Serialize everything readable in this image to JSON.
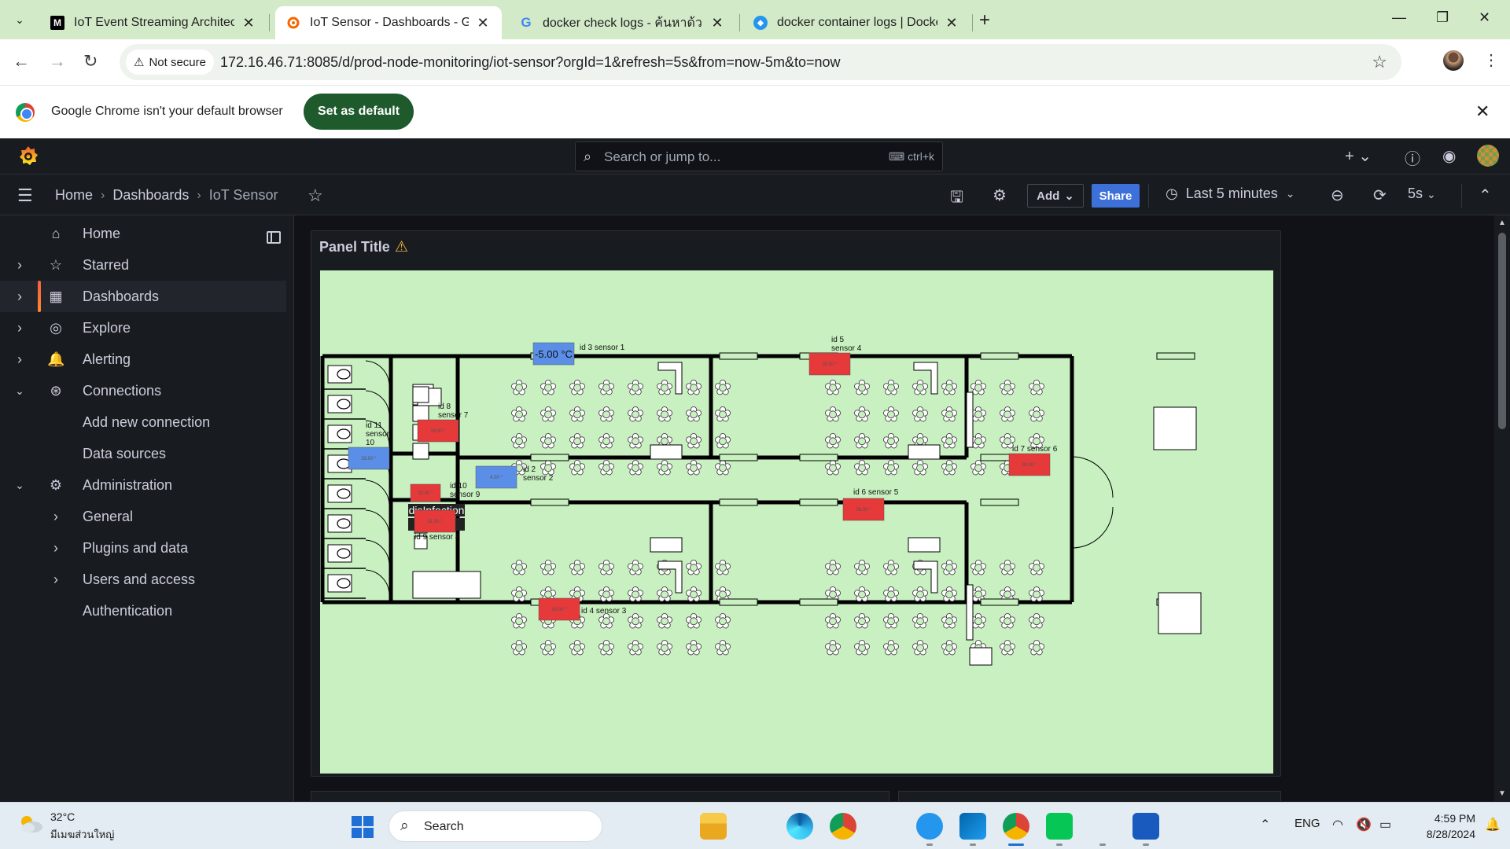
{
  "browser": {
    "tabs": [
      {
        "title": "IoT Event Streaming Architectur",
        "favicon": "M",
        "active": false
      },
      {
        "title": "IoT Sensor - Dashboards - Grafa",
        "favicon": "grafana",
        "active": true
      },
      {
        "title": "docker check logs - ค้นหาด้วย Go",
        "favicon": "G",
        "active": false
      },
      {
        "title": "docker container logs | Docker",
        "favicon": "docker",
        "active": false
      }
    ],
    "security_label": "Not secure",
    "url": "172.16.46.71:8085/d/prod-node-monitoring/iot-sensor?orgId=1&refresh=5s&from=now-5m&to=now",
    "infobar_text": "Google Chrome isn't your default browser",
    "infobar_button": "Set as default"
  },
  "grafana": {
    "search_placeholder": "Search or jump to...",
    "search_shortcut": "ctrl+k",
    "breadcrumbs": [
      "Home",
      "Dashboards",
      "IoT Sensor"
    ],
    "toolbar": {
      "add_label": "Add",
      "share_label": "Share",
      "time_range": "Last 5 minutes",
      "refresh_interval": "5s"
    },
    "sidebar": [
      {
        "label": "Home",
        "icon": "home-icon",
        "level": 0,
        "chevron": "",
        "active": false
      },
      {
        "label": "Starred",
        "icon": "star-icon",
        "level": 0,
        "chevron": "right",
        "active": false
      },
      {
        "label": "Dashboards",
        "icon": "apps-icon",
        "level": 0,
        "chevron": "right",
        "active": true
      },
      {
        "label": "Explore",
        "icon": "compass-icon",
        "level": 0,
        "chevron": "right",
        "active": false
      },
      {
        "label": "Alerting",
        "icon": "bell-icon",
        "level": 0,
        "chevron": "right",
        "active": false
      },
      {
        "label": "Connections",
        "icon": "connections-icon",
        "level": 0,
        "chevron": "down",
        "active": false
      },
      {
        "label": "Add new connection",
        "icon": "",
        "level": 1,
        "chevron": "",
        "active": false
      },
      {
        "label": "Data sources",
        "icon": "",
        "level": 1,
        "chevron": "",
        "active": false
      },
      {
        "label": "Administration",
        "icon": "cog-icon",
        "level": 0,
        "chevron": "down",
        "active": false
      },
      {
        "label": "General",
        "icon": "",
        "level": 2,
        "chevron": "right",
        "active": false
      },
      {
        "label": "Plugins and data",
        "icon": "",
        "level": 2,
        "chevron": "right",
        "active": false
      },
      {
        "label": "Users and access",
        "icon": "",
        "level": 2,
        "chevron": "right",
        "active": false
      },
      {
        "label": "Authentication",
        "icon": "",
        "level": 1,
        "chevron": "",
        "active": false
      }
    ],
    "panel": {
      "title": "Panel Title",
      "room_label": [
        "disInfection",
        "room"
      ],
      "sensors": [
        {
          "id": "id3",
          "label": [
            "id 3 sensor 1"
          ],
          "value": "-5.00 °C",
          "color": "#5b8ee6"
        },
        {
          "id": "id5",
          "label": [
            "id 5",
            "sensor 4"
          ],
          "value": "30.00 °",
          "color": "#e5393a"
        },
        {
          "id": "id8",
          "label": [
            "id 8",
            "sensor 7"
          ],
          "value": "34.00 °",
          "color": "#e5393a"
        },
        {
          "id": "id11",
          "label": [
            "id 11",
            "sensor",
            "10"
          ],
          "value": "33.00 °",
          "color": "#5b8ee6"
        },
        {
          "id": "id2",
          "label": [
            "id 2",
            "sensor 2"
          ],
          "value": "4.00 °",
          "color": "#5b8ee6"
        },
        {
          "id": "id10",
          "label": [
            "id 10",
            "sensor 9"
          ],
          "value": "33.00 °",
          "color": "#e5393a"
        },
        {
          "id": "id9",
          "label": [
            "id 9 sensor 8"
          ],
          "value": "31.00 °",
          "color": "#e5393a"
        },
        {
          "id": "id6",
          "label": [
            "id 6 sensor 5"
          ],
          "value": "36.00 °",
          "color": "#e5393a"
        },
        {
          "id": "id7",
          "label": [
            "id 7 sensor 6"
          ],
          "value": "32.00 °",
          "color": "#e5393a"
        },
        {
          "id": "id4",
          "label": [
            "id 4 sensor 3"
          ],
          "value": "30.00 °",
          "color": "#e5393a"
        }
      ]
    }
  },
  "taskbar": {
    "weather_temp": "32°C",
    "weather_location": "มีเมฆส่วนใหญ่",
    "search_placeholder": "Search",
    "language": "ENG",
    "time": "4:59 PM",
    "date": "8/28/2024"
  }
}
